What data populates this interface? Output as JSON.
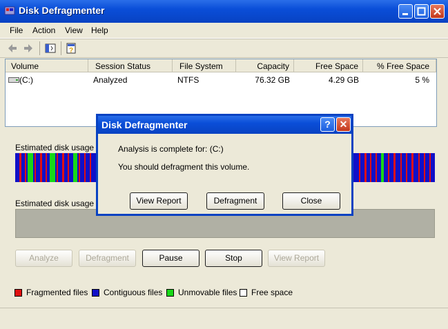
{
  "window": {
    "title": "Disk Defragmenter"
  },
  "menu": [
    "File",
    "Action",
    "View",
    "Help"
  ],
  "volumes": {
    "columns": [
      "Volume",
      "Session Status",
      "File System",
      "Capacity",
      "Free Space",
      "% Free Space"
    ],
    "rows": [
      {
        "volume": "(C:)",
        "status": "Analyzed",
        "fs": "NTFS",
        "capacity": "76.32 GB",
        "free": "4.29 GB",
        "pct": "5 %"
      }
    ]
  },
  "estimate_before_label": "Estimated disk usage be",
  "estimate_after_label": "Estimated disk usage aft",
  "buttons": {
    "analyze": "Analyze",
    "defragment": "Defragment",
    "pause": "Pause",
    "stop": "Stop",
    "view_report": "View Report"
  },
  "legend": [
    {
      "label": "Fragmented files",
      "color": "#e01010"
    },
    {
      "label": "Contiguous files",
      "color": "#1010c8"
    },
    {
      "label": "Unmovable files",
      "color": "#18d818"
    },
    {
      "label": "Free space",
      "color": "#ffffff"
    }
  ],
  "dialog": {
    "title": "Disk Defragmenter",
    "line1": "Analysis is complete for: (C:)",
    "line2": "You should defragment this volume.",
    "buttons": {
      "view_report": "View Report",
      "defragment": "Defragment",
      "close": "Close"
    },
    "help_glyph": "?",
    "close_glyph": "✕"
  },
  "colors": {
    "contiguous": "#1010c8",
    "fragmented": "#e01010",
    "unmovable": "#18d818"
  }
}
